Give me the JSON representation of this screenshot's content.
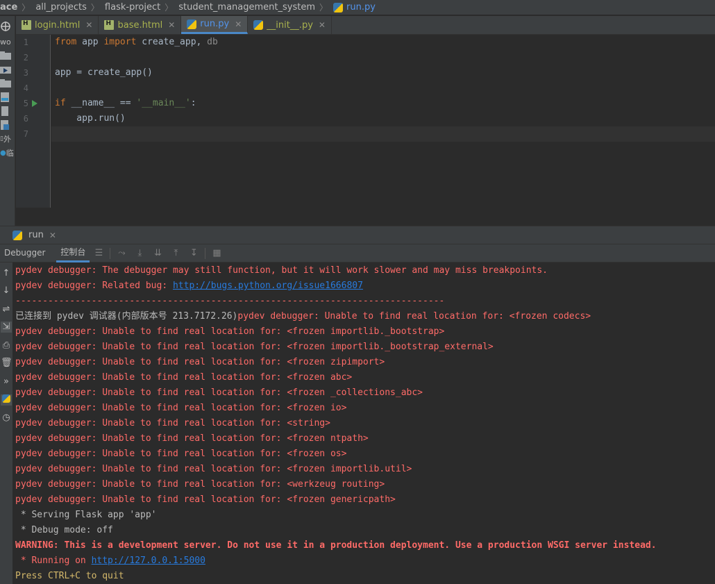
{
  "breadcrumb": {
    "items": [
      "ace",
      "all_projects",
      "flask-project",
      "student_management_system"
    ],
    "file": "run.py"
  },
  "left_strip": {
    "items": [
      "wo",
      "外",
      "临"
    ]
  },
  "tabs": [
    {
      "label": "login.html",
      "icon": "html-file-icon"
    },
    {
      "label": "base.html",
      "icon": "html-file-icon"
    },
    {
      "label": "run.py",
      "icon": "python-file-icon",
      "active": true
    },
    {
      "label": "__init__.py",
      "icon": "python-file-icon"
    }
  ],
  "editor": {
    "line_numbers": [
      "1",
      "2",
      "3",
      "4",
      "5",
      "6",
      "7"
    ],
    "line1": {
      "from": "from",
      "mod": " app ",
      "import": "import",
      "names": " create_app, ",
      "db": "db"
    },
    "line3": {
      "text": "app = create_app()"
    },
    "line5": {
      "if": "if",
      "name": " __name__ == ",
      "main": "'__main__'",
      "colon": ":"
    },
    "line6": {
      "text": "    app.run()"
    }
  },
  "run_panel": {
    "tab_label": "run",
    "debugger_tab": "Debugger",
    "console_tab": "控制台"
  },
  "console": {
    "lines": [
      "pydev debugger: The debugger may still function, but it will work slower and may miss breakpoints.",
      "pydev debugger: Related bug: ",
      "-------------------------------------------------------------------------------",
      "已连接到 pydev 调试器(内部版本号 213.7172.26)",
      "pydev debugger: Unable to find real location for: <frozen codecs>",
      "pydev debugger: Unable to find real location for: <frozen importlib._bootstrap>",
      "pydev debugger: Unable to find real location for: <frozen importlib._bootstrap_external>",
      "pydev debugger: Unable to find real location for: <frozen zipimport>",
      "pydev debugger: Unable to find real location for: <frozen abc>",
      "pydev debugger: Unable to find real location for: <frozen _collections_abc>",
      "pydev debugger: Unable to find real location for: <frozen io>",
      "pydev debugger: Unable to find real location for: <string>",
      "pydev debugger: Unable to find real location for: <frozen ntpath>",
      "pydev debugger: Unable to find real location for: <frozen os>",
      "pydev debugger: Unable to find real location for: <frozen importlib.util>",
      "pydev debugger: Unable to find real location for: <werkzeug routing>",
      "pydev debugger: Unable to find real location for: <frozen genericpath>",
      " * Serving Flask app 'app'",
      " * Debug mode: off",
      "WARNING: This is a development server. Do not use it in a production deployment. Use a production WSGI server instead.",
      " * Running on ",
      "Press CTRL+C to quit"
    ],
    "bug_link": "http://bugs.python.org/issue1666807",
    "server_link": "http://127.0.0.1:5000"
  },
  "colors": {
    "error": "#ff6b68",
    "link": "#287bde",
    "keyword": "#cc7832",
    "string": "#6a8759",
    "accent": "#4a88c7"
  }
}
